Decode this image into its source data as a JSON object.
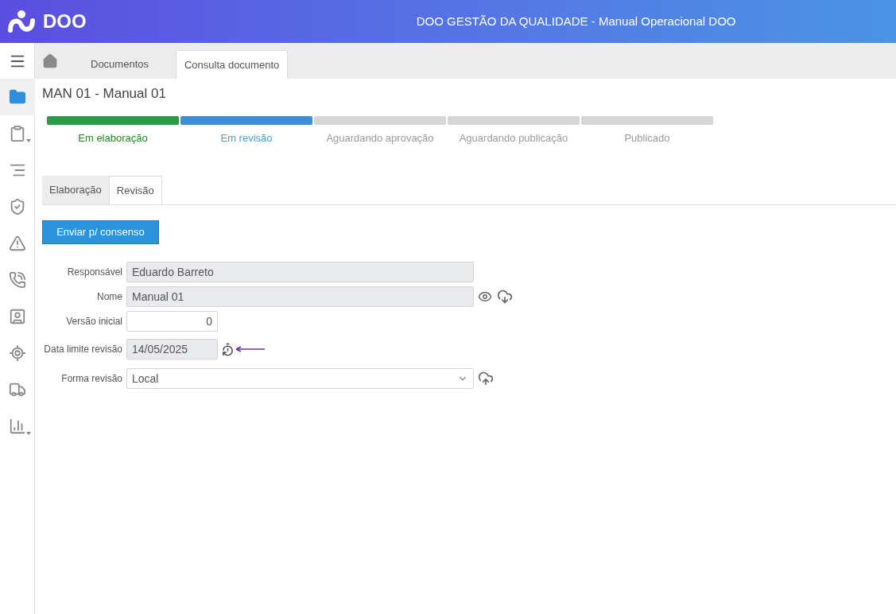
{
  "header": {
    "logo": "DOO",
    "title": "DOO GESTÃO DA QUALIDADE - Manual Operacional DOO"
  },
  "sidebar": {
    "items": [
      {
        "selected": true
      },
      {
        "selected": false
      },
      {
        "selected": false
      },
      {
        "selected": false
      },
      {
        "selected": false
      },
      {
        "selected": false
      },
      {
        "selected": false
      },
      {
        "selected": false
      },
      {
        "selected": false
      },
      {
        "selected": false
      }
    ]
  },
  "nav_tabs": [
    {
      "label": "Documentos",
      "selected": false
    },
    {
      "label": "Consulta documento",
      "selected": true
    }
  ],
  "page_title": "MAN 01 - Manual 01",
  "stages": [
    {
      "label": "Em elaboração",
      "kind": "done"
    },
    {
      "label": "Em revisão",
      "kind": "current"
    },
    {
      "label": "Aguardando aprovação",
      "kind": "pending"
    },
    {
      "label": "Aguardando publicação",
      "kind": "pending"
    },
    {
      "label": "Publicado",
      "kind": "pending"
    }
  ],
  "form_tabs": [
    {
      "label": "Elaboração",
      "selected": false
    },
    {
      "label": "Revisão",
      "selected": true
    }
  ],
  "send_button": "Enviar p/ consenso",
  "fields": [
    {
      "label": "Responsável",
      "value": "Eduardo Barreto",
      "kind": "text",
      "disabled": true
    },
    {
      "label": "Nome",
      "value": "Manual 01",
      "kind": "text",
      "disabled": true
    },
    {
      "label": "Versão inicial",
      "value": "0",
      "kind": "number",
      "disabled": false
    },
    {
      "label": "Data limite revisão",
      "value": "14/05/2025",
      "kind": "date",
      "disabled": true
    },
    {
      "label": "Forma revisão",
      "value": "Local",
      "kind": "select",
      "disabled": false
    }
  ]
}
